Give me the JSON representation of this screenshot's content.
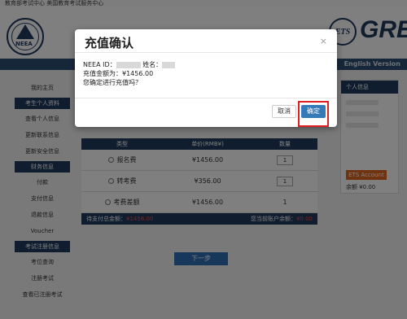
{
  "topbar": {
    "text": "教育部考试中心 美国教育考试服务中心"
  },
  "header": {
    "logo_text": "NEEA",
    "ets_text": "ETS",
    "gre_text": "GRE."
  },
  "navbar": {
    "english_link": "English Version"
  },
  "sidebar": {
    "items": [
      {
        "type": "item",
        "label": "我的主页"
      },
      {
        "type": "head",
        "label": "考生个人资料"
      },
      {
        "type": "item",
        "label": "查看个人信息"
      },
      {
        "type": "item",
        "label": "更新联系信息"
      },
      {
        "type": "item",
        "label": "更新安全信息"
      },
      {
        "type": "head",
        "label": "财务信息"
      },
      {
        "type": "item",
        "label": "付款"
      },
      {
        "type": "item",
        "label": "支付信息"
      },
      {
        "type": "item",
        "label": "退款信息"
      },
      {
        "type": "item",
        "label": "Voucher"
      },
      {
        "type": "head",
        "label": "考试注册信息"
      },
      {
        "type": "item",
        "label": "考位查询"
      },
      {
        "type": "item",
        "label": "注册考试"
      },
      {
        "type": "item",
        "label": "查看已注册考试"
      }
    ]
  },
  "table": {
    "headers": [
      "类型",
      "单价(RMB¥)",
      "数量"
    ],
    "rows": [
      {
        "name": "报名费",
        "price": "¥1456.00",
        "qty": "1"
      },
      {
        "name": "转考费",
        "price": "¥356.00",
        "qty": "1"
      },
      {
        "name": "考费差额",
        "price": "¥1456.00",
        "qty": "1"
      }
    ],
    "footer_left_label": "待支付总金额：",
    "footer_left_value": "¥1456.00",
    "footer_right_label": "您当前账户余额：",
    "footer_right_value": "¥0.00"
  },
  "next_button": "下一步",
  "right_panel": {
    "title": "个人信息",
    "ets_account": "ETS Account",
    "balance": "余额 ¥0.00"
  },
  "modal": {
    "title": "充值确认",
    "close_glyph": "×",
    "neea_label": "NEEA ID：",
    "name_label": "姓名：",
    "amount_line": "充值金额为：¥1456.00",
    "question": "您确定进行充值吗？",
    "cancel_label": "取消",
    "ok_label": "确定"
  },
  "colors": {
    "accent": "#337ab7",
    "nav": "#1f3a5f",
    "highlight": "#e02020"
  }
}
